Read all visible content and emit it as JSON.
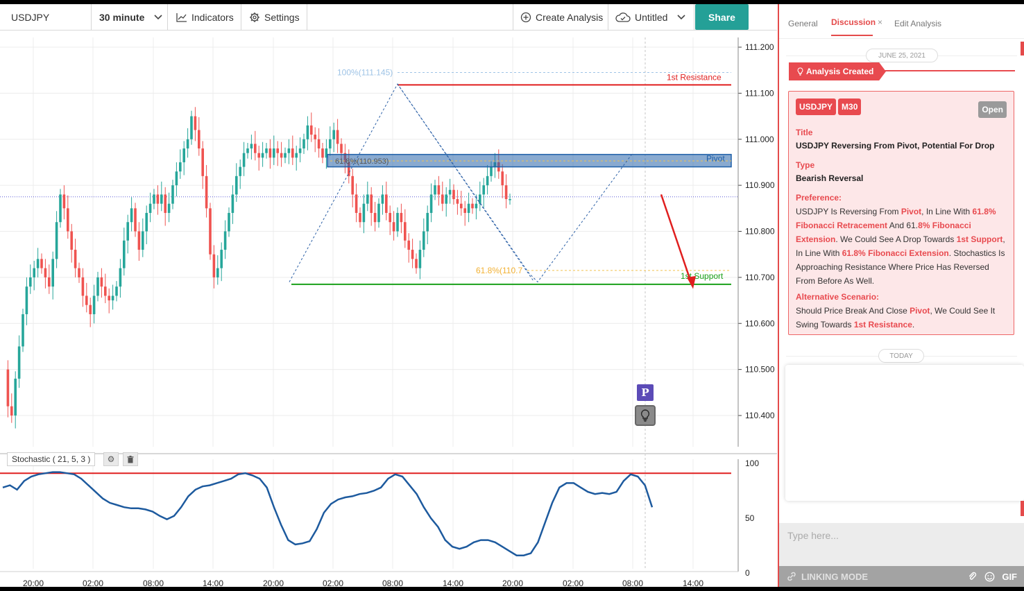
{
  "toolbar": {
    "symbol": "USDJPY",
    "interval": "30 minute",
    "indicators": "Indicators",
    "settings": "Settings",
    "create_analysis": "Create Analysis",
    "layout_name": "Untitled",
    "share": "Share"
  },
  "chart": {
    "price_labels": [
      "111.200",
      "111.100",
      "111.000",
      "110.900",
      "110.800",
      "110.700",
      "110.600",
      "110.500",
      "110.400"
    ],
    "time_labels": [
      "20:00",
      "02:00",
      "08:00",
      "14:00",
      "20:00",
      "02:00",
      "08:00",
      "14:00",
      "20:00",
      "02:00",
      "08:00",
      "14:00"
    ],
    "fib_top": "100%(111.145)",
    "fib_mid": "61.8%(110.953)",
    "fib_low": "61.8%(110.7",
    "resistance_label": "1st Resistance",
    "pivot_label": "Pivot",
    "support_label": "1st Support",
    "colors": {
      "up": "#26a69a",
      "down": "#ef5350",
      "resistance": "#e01e1e",
      "support": "#1aa01a",
      "pivot": "#1e5fa8",
      "stoch": "#1d5a9e"
    }
  },
  "stochastic": {
    "label": "Stochastic ( 21, 5, 3 )",
    "gear_icon": "gear-icon",
    "trash_icon": "trash-icon",
    "levels": [
      "100",
      "50",
      "0"
    ]
  },
  "panel": {
    "tabs": [
      "General",
      "Discussion",
      "Edit Analysis"
    ],
    "tab_close": "×",
    "date": "JUNE 25, 2021",
    "created": "Analysis Created",
    "symbol_tag": "USDJPY",
    "tf_tag": "M30",
    "status": "Open",
    "title_label": "Title",
    "title": "USDJPY Reversing From Pivot, Potential For Drop",
    "type_label": "Type",
    "type": "Bearish Reversal",
    "pref_label": "Preference:",
    "pref": {
      "p1": "USDJPY Is Reversing From ",
      "h1": "Pivot",
      "p2": ", In Line With ",
      "h2": "61.8% Fibonacci Retracement",
      "p3": " And 61.",
      "h3": "8% Fibonacci Extension",
      "p4": ". We Could See A Drop Towards ",
      "h4": "1st Support",
      "p5": ", In Line With ",
      "h5": "61.8% Fibonacci Extension",
      "p6": ". Stochastics Is Approaching Resistance Where Price Has Reversed From Before As Well."
    },
    "alt_label": "Alternative Scenario:",
    "alt": {
      "p1": "Should Price Break And Close ",
      "h1": "Pivot",
      "p2": ", We Could See It Swing Towards ",
      "h2": "1st Resistance",
      "p3": "."
    },
    "today": "TODAY",
    "input_placeholder": "Type here...",
    "linking_mode": "LINKING MODE",
    "gif": "GIF"
  }
}
